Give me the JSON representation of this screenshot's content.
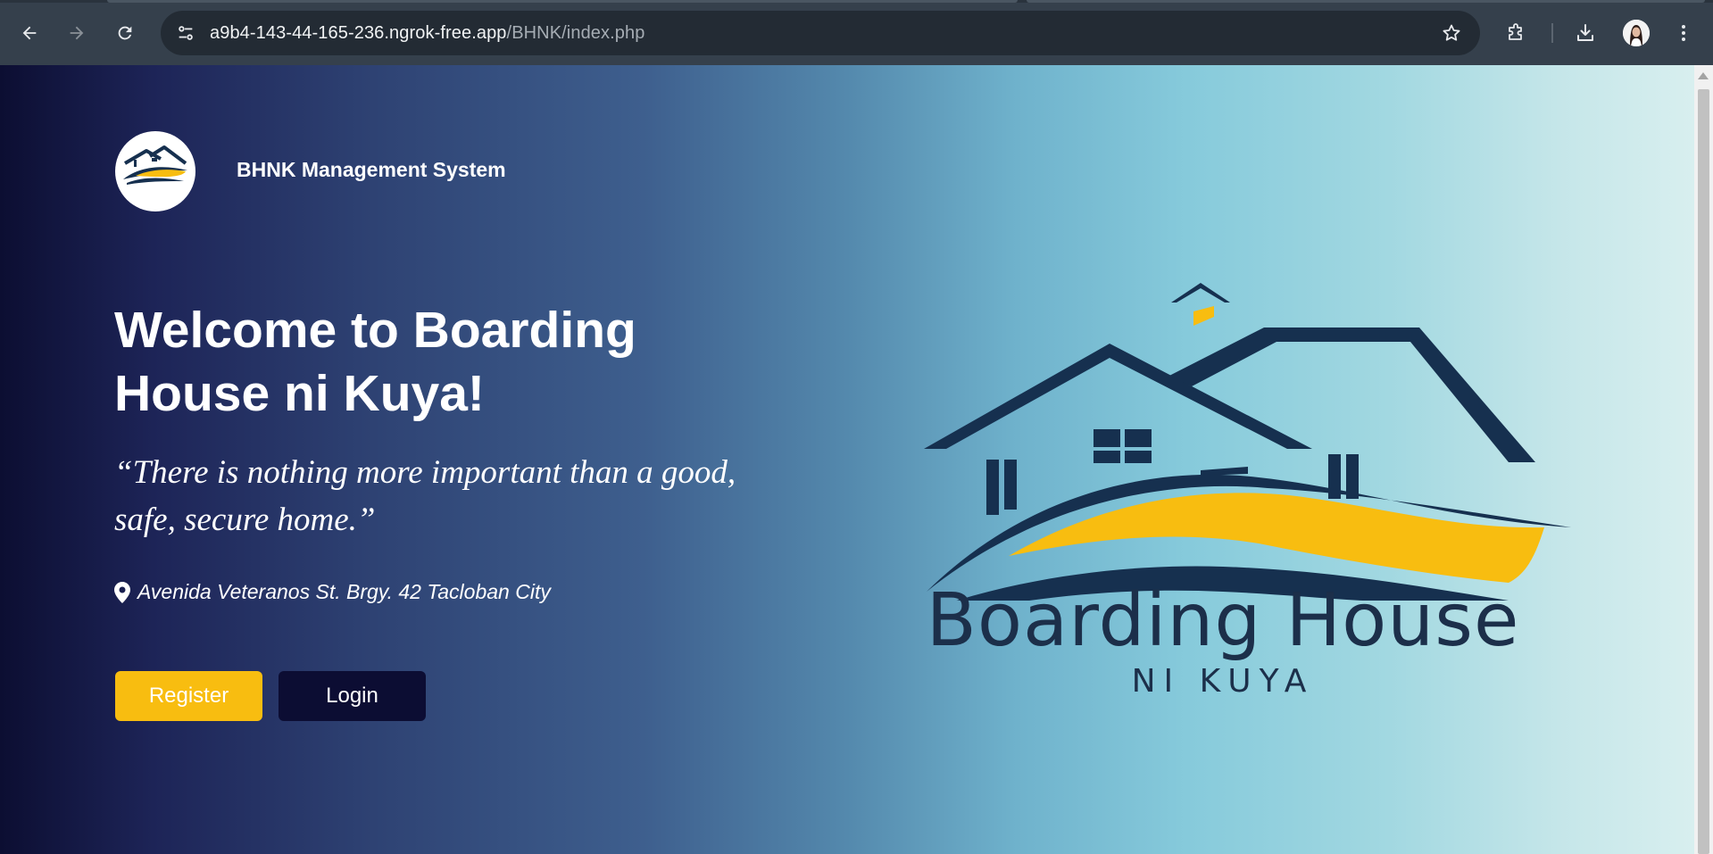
{
  "browser": {
    "url_host": "a9b4-143-44-165-236.ngrok-free.app",
    "url_path": "/BHNK/index.php",
    "icons": {
      "back": "arrow-left-icon",
      "forward": "arrow-right-icon",
      "reload": "reload-icon",
      "site_info": "tune-icon",
      "bookmark": "star-icon",
      "extensions": "puzzle-icon",
      "downloads": "download-icon",
      "profile": "avatar",
      "menu": "kebab-menu-icon"
    }
  },
  "header": {
    "brand": "BHNK Management System",
    "logo_text": "Boarding House"
  },
  "hero": {
    "title": "Welcome to Boarding House ni Kuya!",
    "quote": "“There is nothing more important than a good, safe, secure home.”",
    "address": "Avenida Veteranos St. Brgy. 42 Tacloban City",
    "register_label": "Register",
    "login_label": "Login"
  },
  "logo": {
    "name": "Boarding House",
    "sub": "NI KUYA"
  },
  "colors": {
    "accent_yellow": "#f8bd10",
    "navy": "#0c0d33",
    "logo_navy": "#16304f"
  }
}
